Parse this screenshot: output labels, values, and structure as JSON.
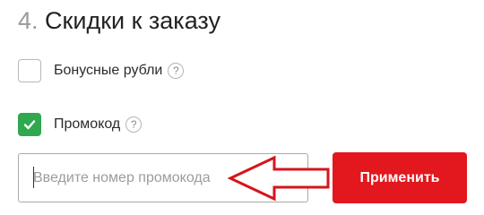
{
  "discounts": {
    "step_number": "4.",
    "title": "Скидки к заказу"
  },
  "bonus": {
    "label": "Бонусные рубли",
    "checked": false,
    "help_glyph": "?"
  },
  "promo": {
    "label": "Промокод",
    "checked": true,
    "help_glyph": "?",
    "input_placeholder": "Введите номер промокода",
    "input_value": "",
    "apply_label": "Применить"
  },
  "icons": {
    "checkmark": "check-icon",
    "help": "question-icon",
    "annotation": "arrow-left-icon"
  },
  "colors": {
    "accent_red": "#e3171e",
    "check_green": "#2fa84f",
    "annotation_red": "#d4161c"
  }
}
